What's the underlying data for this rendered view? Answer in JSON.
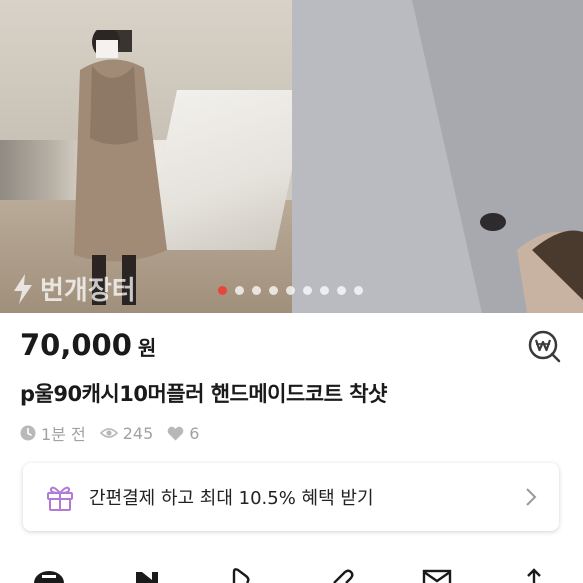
{
  "gallery": {
    "watermark": "번개장터",
    "dot_count": 9,
    "active_index": 0
  },
  "product": {
    "price": "70,000",
    "currency": "원",
    "title": "p울90캐시10머플러 핸드메이드코트 착샷"
  },
  "meta": {
    "time_ago": "1분 전",
    "views": "245",
    "likes": "6"
  },
  "payment_banner": {
    "text": "간편결제 하고 최대 10.5% 혜택 받기"
  },
  "colors": {
    "accent_red": "#e8453c",
    "gift_purple": "#b27ad6",
    "meta_gray": "#a2a2a2"
  },
  "icons": [
    "bolt-icon",
    "won-search-icon",
    "clock-icon",
    "eye-icon",
    "heart-icon",
    "gift-icon",
    "chevron-right-icon",
    "mail-icon",
    "share-icon"
  ]
}
